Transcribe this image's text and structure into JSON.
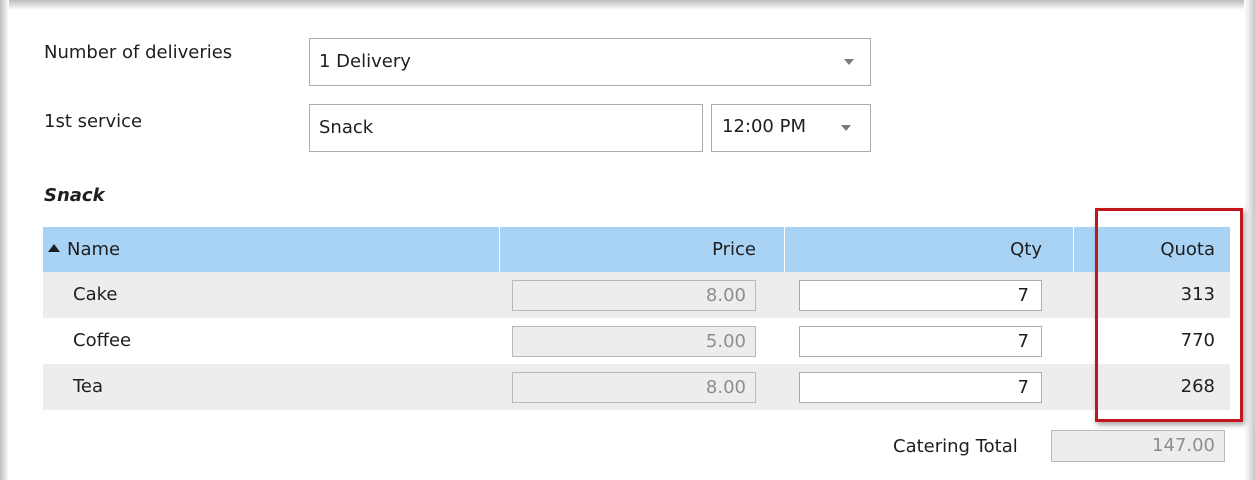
{
  "form": {
    "deliveries_label": "Number of deliveries",
    "deliveries_value": "1 Delivery",
    "service_label": "1st service",
    "service_value": "Snack",
    "time_value": "12:00 PM"
  },
  "section_title": "Snack",
  "table": {
    "columns": [
      "Name",
      "Price",
      "Qty",
      "Quota"
    ],
    "sort": {
      "column": "Name",
      "direction": "ascending"
    },
    "rows": [
      {
        "name": "Cake",
        "price": "8.00",
        "qty": "7",
        "quota": "313"
      },
      {
        "name": "Coffee",
        "price": "5.00",
        "qty": "7",
        "quota": "770"
      },
      {
        "name": "Tea",
        "price": "8.00",
        "qty": "7",
        "quota": "268"
      }
    ]
  },
  "footer": {
    "total_label": "Catering Total",
    "total_value": "147.00"
  },
  "colors": {
    "header_bg": "#a9d3f5",
    "alt_row_bg": "#ededed",
    "highlight_border": "#c0161c"
  },
  "icons": {
    "sort": "sort-ascending-icon",
    "dropdown": "chevron-down-icon"
  }
}
